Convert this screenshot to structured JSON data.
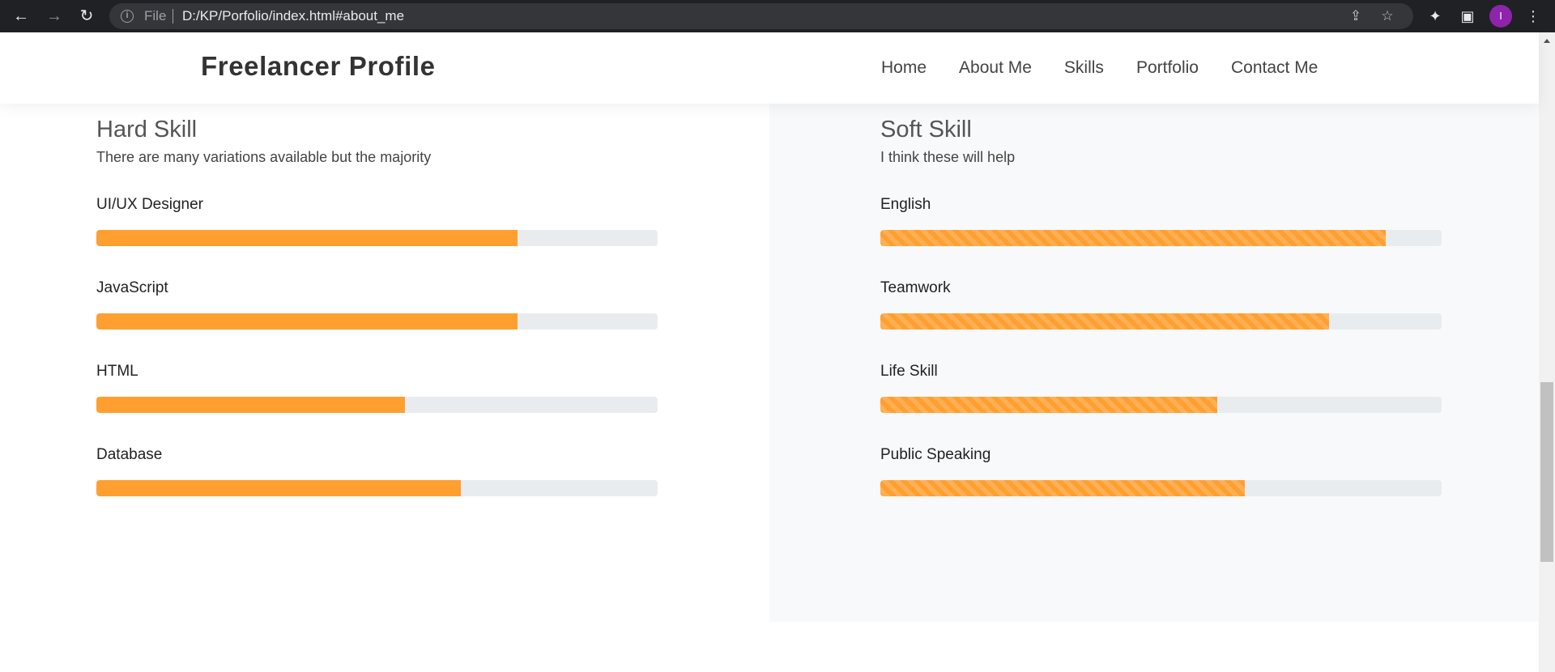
{
  "browser": {
    "back_icon": "←",
    "forward_icon": "→",
    "reload_icon": "↻",
    "scheme_label": "File",
    "url": "D:/KP/Porfolio/index.html#about_me",
    "avatar_letter": "I"
  },
  "header": {
    "brand": "Freelancer Profile",
    "nav": [
      "Home",
      "About Me",
      "Skills",
      "Portfolio",
      "Contact Me"
    ]
  },
  "hard_skill": {
    "title": "Hard Skill",
    "subtitle": "There are many variations available but the majority",
    "skills": [
      {
        "name": "UI/UX Designer",
        "level": 75
      },
      {
        "name": "JavaScript",
        "level": 75
      },
      {
        "name": "HTML",
        "level": 55
      },
      {
        "name": "Database",
        "level": 65
      }
    ]
  },
  "soft_skill": {
    "title": "Soft Skill",
    "subtitle": "I think these will help",
    "skills": [
      {
        "name": "English",
        "level": 90
      },
      {
        "name": "Teamwork",
        "level": 80
      },
      {
        "name": "Life Skill",
        "level": 60
      },
      {
        "name": "Public Speaking",
        "level": 65
      }
    ]
  },
  "colors": {
    "accent": "#ff9f2f",
    "track": "#e9ecef",
    "soft_bg": "#f8f9fa"
  }
}
